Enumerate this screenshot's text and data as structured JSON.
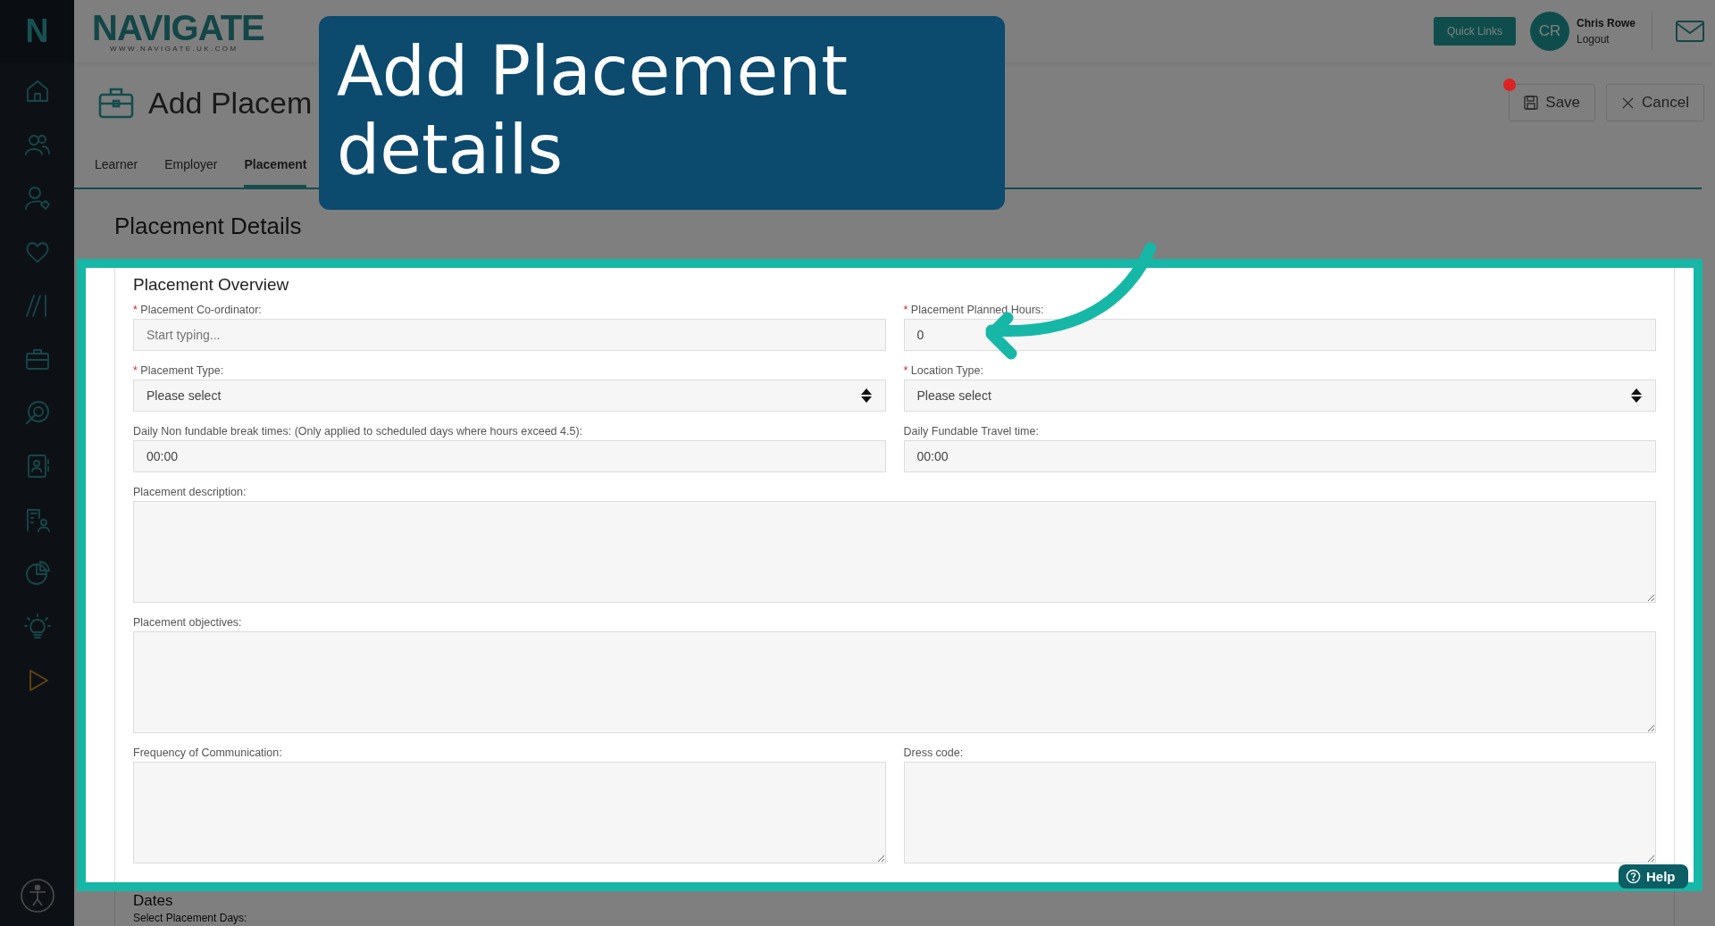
{
  "header": {
    "logo": "NAVIGATE",
    "logo_tagline": "WWW.NAVIGATE.UK.COM",
    "quick_links": "Quick Links",
    "user": {
      "initials": "CR",
      "name": "Chris Rowe",
      "logout": "Logout"
    }
  },
  "sidebar": {
    "logo": "N"
  },
  "page": {
    "title": "Add Placem",
    "actions": [
      {
        "kind": "save",
        "label": "Save",
        "unsaved": true
      },
      {
        "kind": "cancel",
        "label": "Cancel",
        "unsaved": false
      }
    ]
  },
  "tabs": [
    {
      "label": "Learner",
      "selected": false
    },
    {
      "label": "Employer",
      "selected": false
    },
    {
      "label": "Placement",
      "selected": true
    }
  ],
  "section_title": "Placement Details",
  "form": {
    "title": "Placement Overview",
    "rows": [
      [
        {
          "label": "Placement Co-ordinator:",
          "required_mark": "*",
          "kind": "text",
          "placeholder": "Start typing..."
        },
        {
          "label": "Placement Planned Hours:",
          "required_mark": "*",
          "kind": "text",
          "value": "0"
        }
      ],
      [
        {
          "label": "Placement Type:",
          "required_mark": "*",
          "kind": "select",
          "value": "Please select"
        },
        {
          "label": "Location Type:",
          "required_mark": "*",
          "kind": "select",
          "value": "Please select"
        }
      ],
      [
        {
          "label": "Daily Non fundable break times: (Only applied to scheduled days where hours exceed 4.5):",
          "kind": "text",
          "value": "00:00"
        },
        {
          "label": "Daily Fundable Travel time:",
          "kind": "text",
          "value": "00:00"
        }
      ],
      [
        {
          "label": "Placement description:",
          "kind": "textarea"
        }
      ],
      [
        {
          "label": "Placement objectives:",
          "kind": "textarea"
        }
      ],
      [
        {
          "label": "Frequency of Communication:",
          "kind": "textarea"
        },
        {
          "label": "Dress code:",
          "kind": "textarea"
        }
      ]
    ]
  },
  "next_section": {
    "title": "Dates",
    "label": "Select Placement Days:"
  },
  "callout": {
    "text": "Add Placement details"
  },
  "help": {
    "label": "Help"
  }
}
